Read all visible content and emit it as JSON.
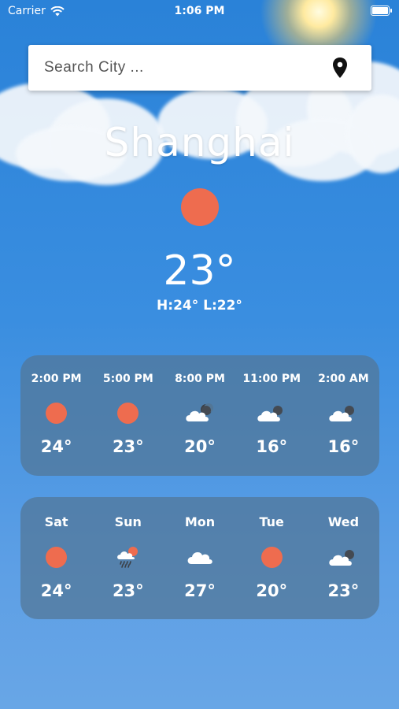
{
  "status_bar": {
    "carrier": "Carrier",
    "time": "1:06 PM"
  },
  "search": {
    "placeholder": "Search City ..."
  },
  "current": {
    "city": "Shanghai",
    "temperature": "23°",
    "hi_lo": "H:24°  L:22°",
    "icon": "sun-icon"
  },
  "hourly": [
    {
      "time": "2:00 PM",
      "temp": "24°",
      "icon": "sun-icon"
    },
    {
      "time": "5:00 PM",
      "temp": "23°",
      "icon": "sun-icon"
    },
    {
      "time": "8:00 PM",
      "temp": "20°",
      "icon": "cloudy-night-icon"
    },
    {
      "time": "11:00 PM",
      "temp": "16°",
      "icon": "cloudy-night-icon"
    },
    {
      "time": "2:00 AM",
      "temp": "16°",
      "icon": "cloudy-night-icon"
    }
  ],
  "daily": [
    {
      "day": "Sat",
      "temp": "24°",
      "icon": "sun-icon"
    },
    {
      "day": "Sun",
      "temp": "23°",
      "icon": "rain-sun-icon"
    },
    {
      "day": "Mon",
      "temp": "27°",
      "icon": "cloud-icon"
    },
    {
      "day": "Tue",
      "temp": "20°",
      "icon": "sun-icon"
    },
    {
      "day": "Wed",
      "temp": "23°",
      "icon": "cloudy-night-icon"
    }
  ],
  "colors": {
    "sun": "#ee6c4f",
    "sky_top": "#2a82d8",
    "sky_bottom": "#68a6e6",
    "card": "#527696"
  }
}
